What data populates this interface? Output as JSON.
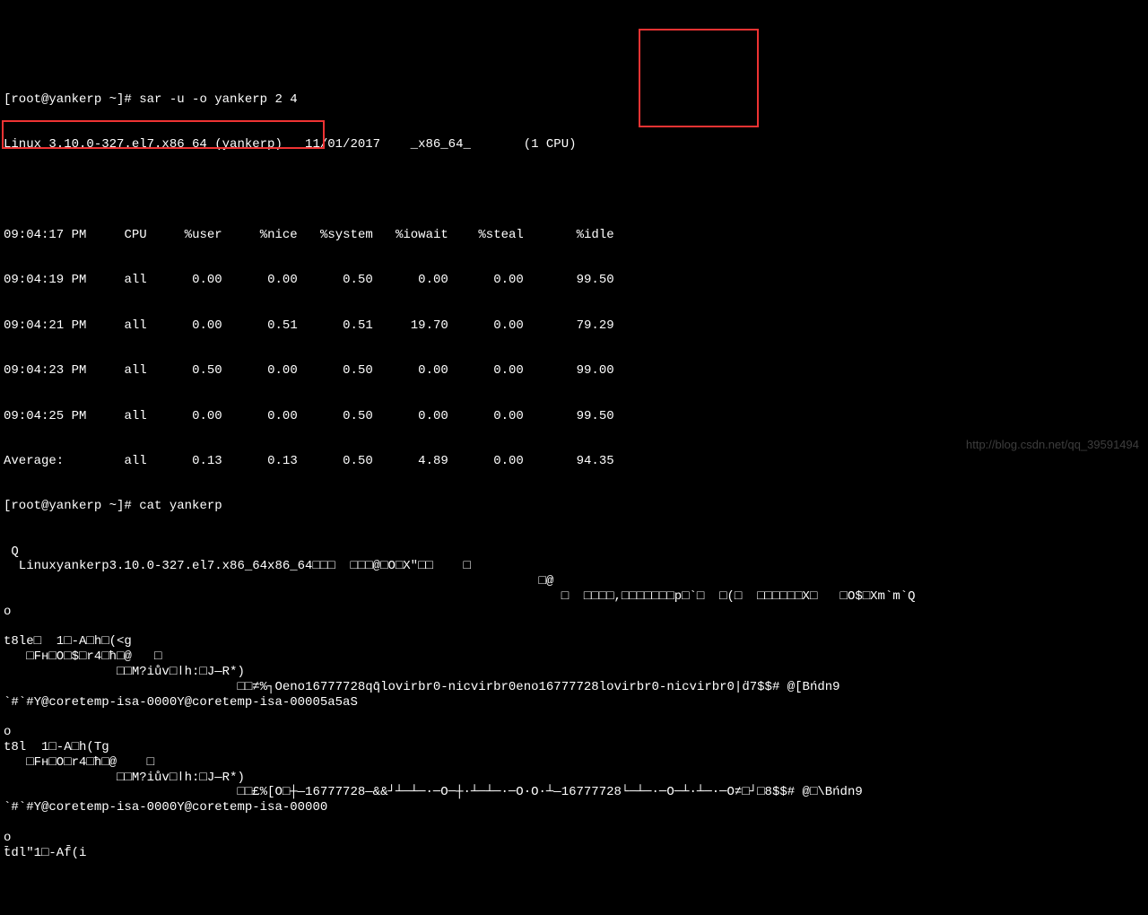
{
  "prompt1": "[root@yankerp ~]# ",
  "command1": "sar -u -o yankerp 2 4",
  "kernel_line": "Linux 3.10.0-327.el7.x86_64 (yankerp)   11/01/2017    _x86_64_       (1 CPU)",
  "headers": {
    "time": "09:04:17 PM",
    "cpu": "CPU",
    "user": "%user",
    "nice": "%nice",
    "system": "%system",
    "iowait": "%iowait",
    "steal": "%steal",
    "idle": "%idle"
  },
  "rows": [
    {
      "time": "09:04:19 PM",
      "cpu": "all",
      "user": "0.00",
      "nice": "0.00",
      "system": "0.50",
      "iowait": "0.00",
      "steal": "0.00",
      "idle": "99.50"
    },
    {
      "time": "09:04:21 PM",
      "cpu": "all",
      "user": "0.00",
      "nice": "0.51",
      "system": "0.51",
      "iowait": "19.70",
      "steal": "0.00",
      "idle": "79.29"
    },
    {
      "time": "09:04:23 PM",
      "cpu": "all",
      "user": "0.50",
      "nice": "0.00",
      "system": "0.50",
      "iowait": "0.00",
      "steal": "0.00",
      "idle": "99.00"
    },
    {
      "time": "09:04:25 PM",
      "cpu": "all",
      "user": "0.00",
      "nice": "0.00",
      "system": "0.50",
      "iowait": "0.00",
      "steal": "0.00",
      "idle": "99.50"
    },
    {
      "time": "Average:   ",
      "cpu": "all",
      "user": "0.13",
      "nice": "0.13",
      "system": "0.50",
      "iowait": "4.89",
      "steal": "0.00",
      "idle": "94.35"
    }
  ],
  "prompt2": "[root@yankerp ~]# ",
  "command2": "cat yankerp",
  "binary_output": [
    " Q",
    "  Linuxyankerp3.10.0-327.el7.x86_64x86_64□□□  □□□@□O□X\"□□    □",
    "                                                                       □@",
    "                                                                          □  □□□□,□□□□□□□p□`□  □(□  □□□□□□X□   □O$□Xm`m`Q",
    "o",
    "",
    "t8le□  1□-A□h□(<g",
    "   □Fн□O□$□r4□ћ□@   □",
    "               □□M?iův□ǀh:□J—R*)",
    "                               □□≠%┐Oeno16777728qq̄lovirbr0-nicvirbr0eno16777728lovirbr0-nicvirbr0|ḋ7$$# @[Bńdn9",
    "`#`#Y@coretemp-isa-0000Y@coretemp-isa-00005a5aS",
    "",
    "o",
    "t8l  1□-A□h(Tg",
    "   □Fн□O□r4□ћ□@    □",
    "               □□M?iův□ǀh:□J—R*)",
    "                               □□£%[O□┼—16777728—&&┘┴─┴─·─O─┼·┴─┴─·─O·O·┴—16777728└─┴─·─O─┴·┴─·─O≠□┘□8$$# @□\\Bńdn9",
    "`#`#Y@coretemp-isa-0000Y@coretemp-isa-00000",
    "",
    "o",
    "t̄dl\"1□-Af̄(i"
  ],
  "watermark": "http://blog.csdn.net/qq_39591494"
}
